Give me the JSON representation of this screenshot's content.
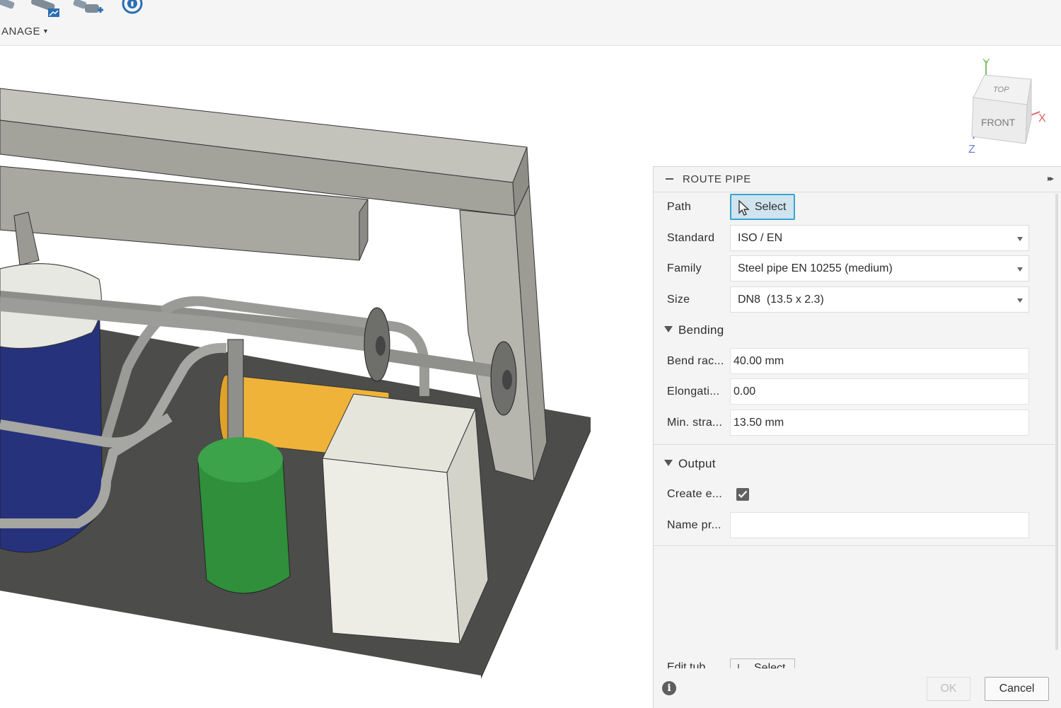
{
  "toolbar": {
    "section_label": "ANAGE",
    "icons": [
      "pipe-icon",
      "pipe-drawing-icon",
      "pipe-fitting-icon",
      "info-icon"
    ]
  },
  "viewcube": {
    "top_label": "TOP",
    "front_label": "FRONT",
    "axis_x": "X",
    "axis_y": "Y",
    "axis_z": "Z"
  },
  "panel": {
    "title": "ROUTE PIPE",
    "path": {
      "label": "Path",
      "button": "Select"
    },
    "standard": {
      "label": "Standard",
      "value": "ISO / EN"
    },
    "family": {
      "label": "Family",
      "value": "Steel pipe EN 10255 (medium)"
    },
    "size": {
      "label": "Size",
      "value": "DN8  (13.5 x 2.3)"
    },
    "bending": {
      "title": "Bending",
      "bend_radius": {
        "label": "Bend rac...",
        "value": "40.00 mm"
      },
      "elongation": {
        "label": "Elongati...",
        "value": "0.00"
      },
      "min_straight": {
        "label": "Min. stra...",
        "value": "13.50 mm"
      }
    },
    "output": {
      "title": "Output",
      "create": {
        "label": "Create e...",
        "checked": true
      },
      "name": {
        "label": "Name pr...",
        "value": ""
      }
    },
    "cut_row": {
      "label": "Edit tub",
      "button": "Select"
    },
    "footer": {
      "info": "i",
      "ok": "OK",
      "cancel": "Cancel"
    }
  },
  "colors": {
    "accent": "#35a3d1",
    "tank_blue": "#24307a",
    "tank_green": "#2f8f3a",
    "tank_yellow": "#f0b23a",
    "base_plate": "#4a4a48",
    "frame": "#b9b8b1"
  }
}
